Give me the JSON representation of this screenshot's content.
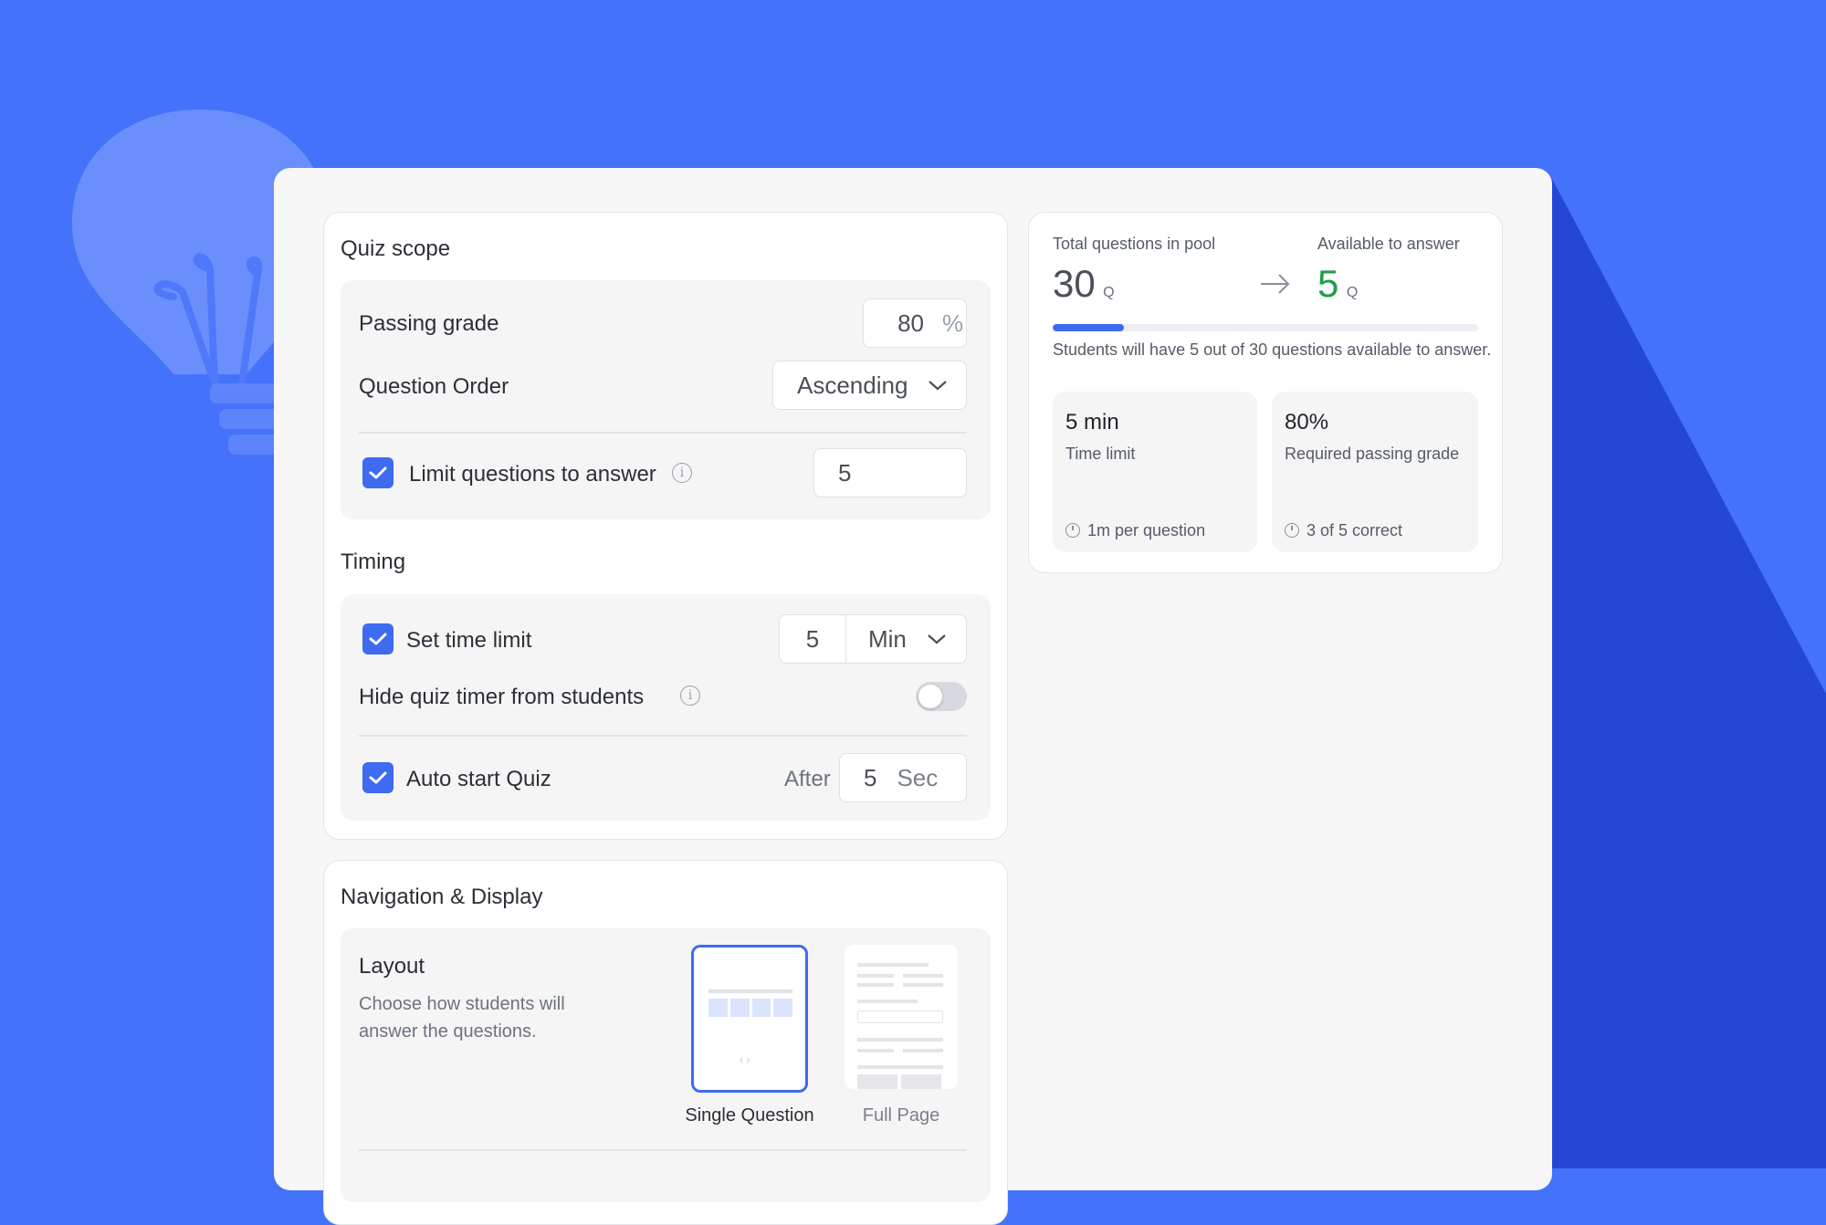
{
  "colors": {
    "background": "#4572fb",
    "accent": "#3e6bf0",
    "available": "#1f9d4a"
  },
  "quiz_scope": {
    "title": "Quiz scope",
    "passing_grade": {
      "label": "Passing grade",
      "value": "80",
      "unit": "%"
    },
    "question_order": {
      "label": "Question Order",
      "value": "Ascending"
    },
    "limit_questions": {
      "label": "Limit questions to answer",
      "checked": true,
      "value": "5"
    }
  },
  "timing": {
    "title": "Timing",
    "time_limit": {
      "label": "Set time limit",
      "checked": true,
      "value": "5",
      "unit": "Min"
    },
    "hide_timer": {
      "label": "Hide quiz timer from students",
      "on": false
    },
    "auto_start": {
      "label": "Auto start Quiz",
      "checked": true,
      "after_label": "After",
      "value": "5",
      "unit": "Sec"
    }
  },
  "navigation": {
    "title": "Navigation & Display",
    "layout_label": "Layout",
    "layout_desc_line1": "Choose how students will",
    "layout_desc_line2": "answer the questions.",
    "options": [
      "Single Question",
      "Full Page"
    ],
    "selected": "Single Question"
  },
  "summary": {
    "total_label": "Total questions in pool",
    "total_value": "30",
    "total_unit": "Q",
    "available_label": "Available to answer",
    "available_value": "5",
    "available_unit": "Q",
    "progress_fraction": 0.1667,
    "note": "Students will have 5 out of 30 questions available to answer.",
    "time": {
      "value": "5 min",
      "label": "Time limit",
      "detail": "1m per question"
    },
    "grade": {
      "value": "80%",
      "label": "Required passing grade",
      "detail": "3 of 5 correct"
    }
  }
}
